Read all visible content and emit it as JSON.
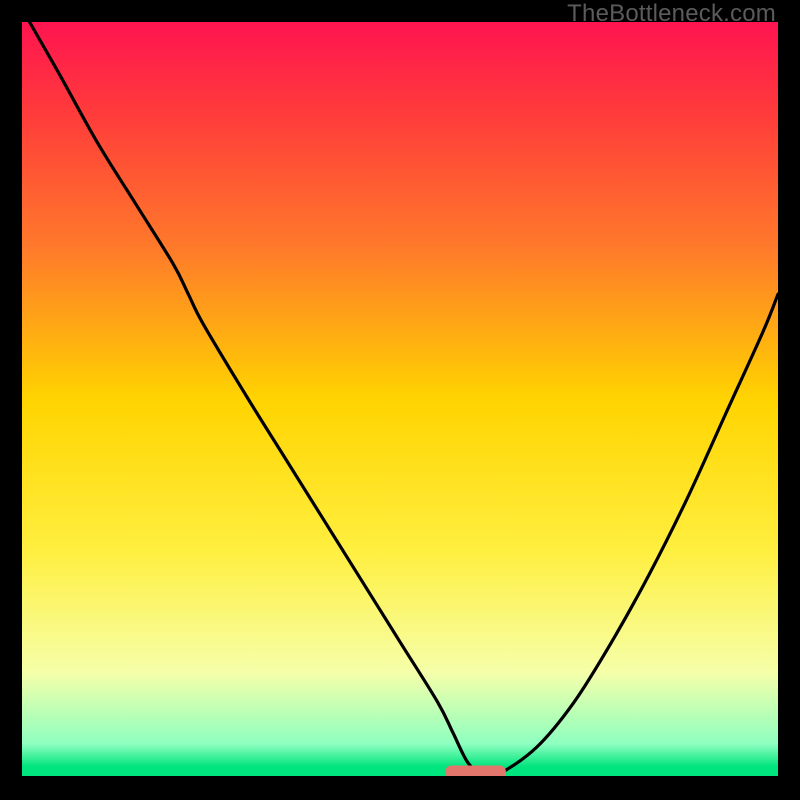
{
  "watermark": "TheBottleneck.com",
  "chart_data": {
    "type": "line",
    "title": "",
    "xlabel": "",
    "ylabel": "",
    "xlim": [
      0,
      100
    ],
    "ylim": [
      0,
      100
    ],
    "grid": false,
    "legend": false,
    "background": {
      "type": "vertical-gradient",
      "stops": [
        {
          "pos": 0.0,
          "color": "#ff1450"
        },
        {
          "pos": 0.12,
          "color": "#ff3b3b"
        },
        {
          "pos": 0.3,
          "color": "#ff7a2a"
        },
        {
          "pos": 0.5,
          "color": "#ffd400"
        },
        {
          "pos": 0.7,
          "color": "#ffef40"
        },
        {
          "pos": 0.86,
          "color": "#f6ffa9"
        },
        {
          "pos": 0.955,
          "color": "#8effc0"
        },
        {
          "pos": 0.985,
          "color": "#00e57d"
        },
        {
          "pos": 1.0,
          "color": "#00e57d"
        }
      ]
    },
    "series": [
      {
        "name": "bottleneck-curve",
        "color": "#000000",
        "x": [
          1,
          5,
          10,
          15,
          20,
          22,
          24,
          30,
          35,
          40,
          45,
          50,
          55,
          57,
          59,
          61,
          63,
          68,
          73,
          78,
          83,
          88,
          93,
          98,
          100
        ],
        "y": [
          100,
          93,
          84,
          76,
          68,
          64,
          60,
          50,
          42,
          34,
          26,
          18,
          10,
          6,
          2,
          0.5,
          0.5,
          4,
          10,
          18,
          27,
          37,
          48,
          59,
          64
        ]
      }
    ],
    "marker": {
      "shape": "rounded-bar",
      "color": "#e2766d",
      "x_center": 60,
      "width": 8,
      "y": 0.8
    }
  }
}
